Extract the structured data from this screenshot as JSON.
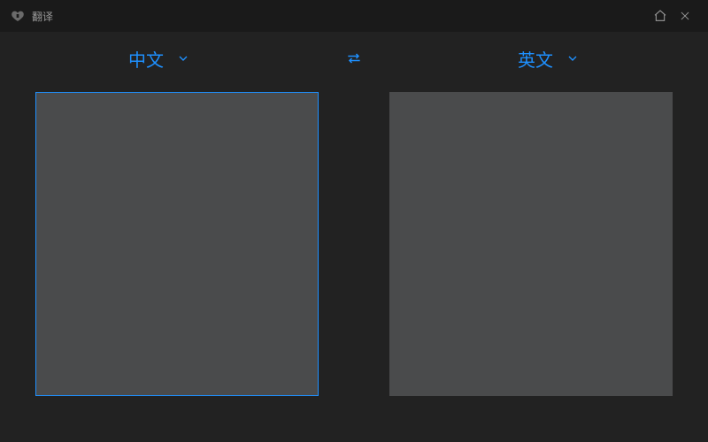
{
  "titlebar": {
    "title": "翻译"
  },
  "languages": {
    "source_label": "中文",
    "target_label": "英文"
  }
}
